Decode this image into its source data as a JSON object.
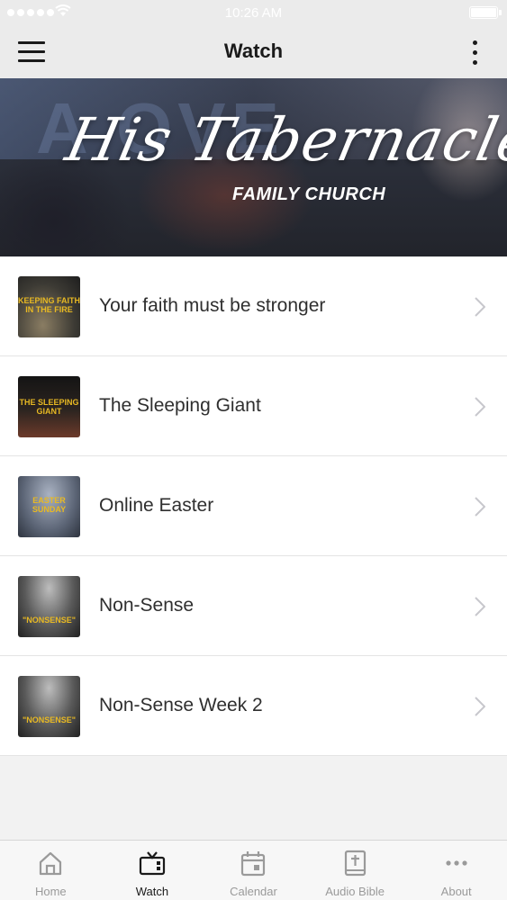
{
  "status_bar": {
    "time": "10:26 AM"
  },
  "nav": {
    "title": "Watch"
  },
  "banner": {
    "title_script": "His Tabernacle",
    "subtitle": "FAMILY CHURCH"
  },
  "videos": [
    {
      "title": "Your faith must be stronger",
      "thumb_text": "KEEPING FAITH IN THE FIRE"
    },
    {
      "title": "The Sleeping Giant",
      "thumb_text": "THE SLEEPING GIANT"
    },
    {
      "title": "Online Easter",
      "thumb_text": "EASTER SUNDAY"
    },
    {
      "title": "Non-Sense",
      "thumb_text": "\"NONSENSE\""
    },
    {
      "title": "Non-Sense Week 2",
      "thumb_text": "\"NONSENSE\""
    }
  ],
  "tabs": [
    {
      "label": "Home",
      "icon": "home-icon",
      "active": false
    },
    {
      "label": "Watch",
      "icon": "tv-icon",
      "active": true
    },
    {
      "label": "Calendar",
      "icon": "calendar-icon",
      "active": false
    },
    {
      "label": "Audio Bible",
      "icon": "bible-icon",
      "active": false
    },
    {
      "label": "About",
      "icon": "more-dots-icon",
      "active": false
    }
  ],
  "colors": {
    "bar_bg": "#ebebeb",
    "active_tab": "#1a1a1a",
    "inactive_tab": "#9a9a9a",
    "thumb_text": "#e8b923"
  }
}
